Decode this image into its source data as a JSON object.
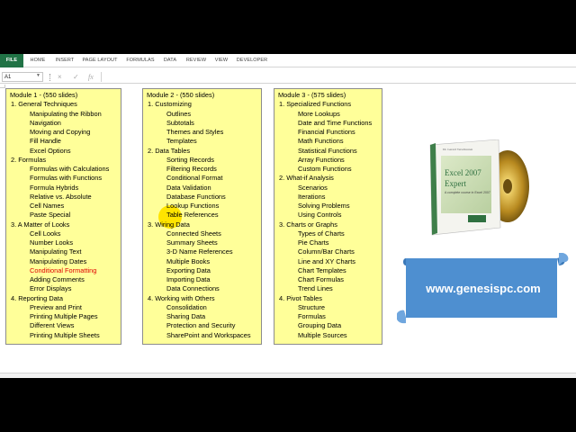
{
  "ribbon": {
    "tabs": [
      "FILE",
      "HOME",
      "INSERT",
      "PAGE LAYOUT",
      "FORMULAS",
      "DATA",
      "REVIEW",
      "VIEW",
      "DEVELOPER"
    ]
  },
  "formula_bar": {
    "name_box": "A1",
    "fx_label": "fx",
    "cancel_glyph": "×",
    "enter_glyph": "✓",
    "value": ""
  },
  "modules": [
    {
      "title": "Module 1 - (550 slides)",
      "lines": [
        {
          "text": "1. General Techniques",
          "level": "sec"
        },
        {
          "text": "Manipulating the Ribbon",
          "level": "sub"
        },
        {
          "text": "Navigation",
          "level": "sub"
        },
        {
          "text": "Moving and Copying",
          "level": "sub"
        },
        {
          "text": "Fill Handle",
          "level": "sub"
        },
        {
          "text": "Excel Options",
          "level": "sub"
        },
        {
          "text": "2. Formulas",
          "level": "sec"
        },
        {
          "text": "Formulas with Calculations",
          "level": "sub"
        },
        {
          "text": "Formulas with Functions",
          "level": "sub"
        },
        {
          "text": "Formula Hybrids",
          "level": "sub"
        },
        {
          "text": "Relative vs. Absolute",
          "level": "sub"
        },
        {
          "text": "Cell Names",
          "level": "sub"
        },
        {
          "text": "Paste Special",
          "level": "sub"
        },
        {
          "text": "3. A Matter of Looks",
          "level": "sec"
        },
        {
          "text": "Cell Looks",
          "level": "sub"
        },
        {
          "text": "Number Looks",
          "level": "sub"
        },
        {
          "text": "Manipulating Text",
          "level": "sub"
        },
        {
          "text": "Manipulating Dates",
          "level": "sub"
        },
        {
          "text": "Conditional Formatting",
          "level": "sub",
          "red": true
        },
        {
          "text": "Adding Comments",
          "level": "sub"
        },
        {
          "text": "Error Displays",
          "level": "sub"
        },
        {
          "text": "4. Reporting Data",
          "level": "sec"
        },
        {
          "text": "Preview and Print",
          "level": "sub"
        },
        {
          "text": "Printing Multiple Pages",
          "level": "sub"
        },
        {
          "text": "Different Views",
          "level": "sub"
        },
        {
          "text": "Printing Multiple Sheets",
          "level": "sub"
        }
      ]
    },
    {
      "title": "Module 2 - (550 slides)",
      "lines": [
        {
          "text": "1. Customizing",
          "level": "sec"
        },
        {
          "text": "Outlines",
          "level": "sub"
        },
        {
          "text": "Subtotals",
          "level": "sub"
        },
        {
          "text": "Themes and Styles",
          "level": "sub"
        },
        {
          "text": "Templates",
          "level": "sub"
        },
        {
          "text": "2. Data Tables",
          "level": "sec"
        },
        {
          "text": "Sorting Records",
          "level": "sub"
        },
        {
          "text": "Filtering Records",
          "level": "sub"
        },
        {
          "text": "Conditional Format",
          "level": "sub"
        },
        {
          "text": "Data Validation",
          "level": "sub"
        },
        {
          "text": "Database Functions",
          "level": "sub"
        },
        {
          "text": "Lookup Functions",
          "level": "sub"
        },
        {
          "text": "Table References",
          "level": "sub"
        },
        {
          "text": "3. Wiring Data",
          "level": "sec"
        },
        {
          "text": "Connected Sheets",
          "level": "sub"
        },
        {
          "text": "Summary Sheets",
          "level": "sub"
        },
        {
          "text": "3-D Name References",
          "level": "sub"
        },
        {
          "text": "Multiple Books",
          "level": "sub"
        },
        {
          "text": "Exporting Data",
          "level": "sub"
        },
        {
          "text": "Importing Data",
          "level": "sub"
        },
        {
          "text": "Data Connections",
          "level": "sub"
        },
        {
          "text": "4. Working with Others",
          "level": "sec"
        },
        {
          "text": "Consolidation",
          "level": "sub"
        },
        {
          "text": "Sharing Data",
          "level": "sub"
        },
        {
          "text": "Protection and Security",
          "level": "sub"
        },
        {
          "text": "SharePoint and Workspaces",
          "level": "sub"
        }
      ]
    },
    {
      "title": "Module 3 - (575 slides)",
      "lines": [
        {
          "text": "1. Specialized Functions",
          "level": "sec"
        },
        {
          "text": "More Lookups",
          "level": "sub"
        },
        {
          "text": "Date and Time Functions",
          "level": "sub"
        },
        {
          "text": "Financial Functions",
          "level": "sub"
        },
        {
          "text": "Math Functions",
          "level": "sub"
        },
        {
          "text": "Statistical Functions",
          "level": "sub"
        },
        {
          "text": "Array Functions",
          "level": "sub"
        },
        {
          "text": "Custom Functions",
          "level": "sub"
        },
        {
          "text": "2. What-if Analysis",
          "level": "sec"
        },
        {
          "text": "Scenarios",
          "level": "sub"
        },
        {
          "text": "Iterations",
          "level": "sub"
        },
        {
          "text": "Solving Problems",
          "level": "sub"
        },
        {
          "text": "Using Controls",
          "level": "sub"
        },
        {
          "text": "3. Charts or Graphs",
          "level": "sec"
        },
        {
          "text": "Types of Charts",
          "level": "sub"
        },
        {
          "text": "Pie Charts",
          "level": "sub"
        },
        {
          "text": "Column/Bar Charts",
          "level": "sub"
        },
        {
          "text": "Line and XY Charts",
          "level": "sub"
        },
        {
          "text": "Chart Templates",
          "level": "sub"
        },
        {
          "text": "Chart Formulas",
          "level": "sub"
        },
        {
          "text": "Trend Lines",
          "level": "sub"
        },
        {
          "text": "4. Pivot Tables",
          "level": "sec"
        },
        {
          "text": "Structure",
          "level": "sub"
        },
        {
          "text": "Formulas",
          "level": "sub"
        },
        {
          "text": "Grouping Data",
          "level": "sub"
        },
        {
          "text": "Multiple Sources",
          "level": "sub"
        }
      ]
    }
  ],
  "product": {
    "author": "Dr. Gerard Verschuuren",
    "title_line1": "Excel 2007",
    "title_line2": "Expert",
    "subtitle": "A complete course in Excel 2007"
  },
  "banner": {
    "url": "www.genesispc.com"
  },
  "colors": {
    "file_tab": "#217346",
    "module_fill": "#ffff99",
    "highlight": "#ffe400",
    "banner": "#4e8fd0",
    "red_text": "#e00000"
  }
}
